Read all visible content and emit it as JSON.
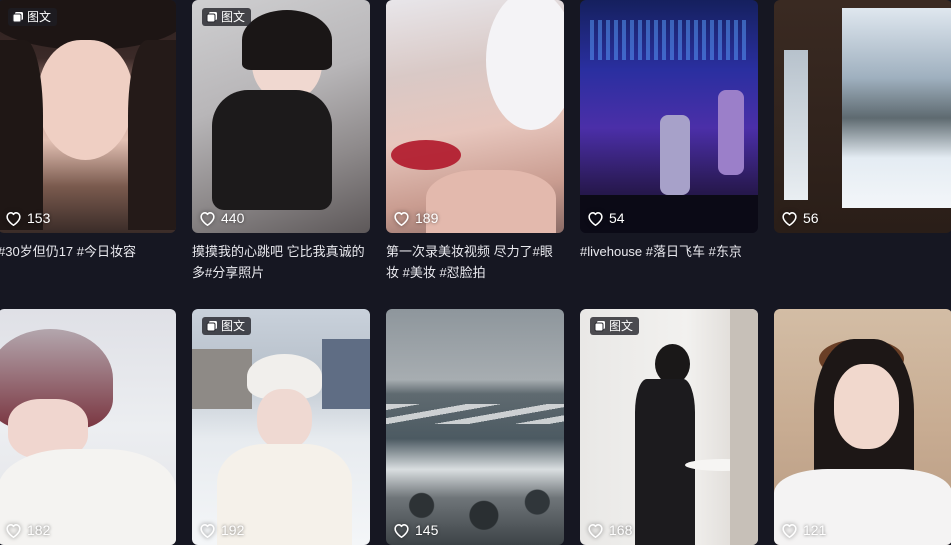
{
  "feed": {
    "badge_label": "图文",
    "row1": [
      {
        "likes": "153",
        "caption": "#30岁但仍17 #今日妆容",
        "badge": true
      },
      {
        "likes": "440",
        "caption": "摸摸我的心跳吧 它比我真诚的多#分享照片",
        "badge": true
      },
      {
        "likes": "189",
        "caption": "第一次录美妆视频 尽力了#眼妆 #美妆 #怼脸拍",
        "badge": false
      },
      {
        "likes": "54",
        "caption": "#livehouse #落日飞车 #东京",
        "badge": false
      },
      {
        "likes": "56",
        "caption": "",
        "badge": false
      }
    ],
    "row2": [
      {
        "likes": "182",
        "badge": false
      },
      {
        "likes": "192",
        "badge": true
      },
      {
        "likes": "145",
        "badge": false
      },
      {
        "likes": "168",
        "badge": true
      },
      {
        "likes": "121",
        "badge": false
      }
    ]
  }
}
